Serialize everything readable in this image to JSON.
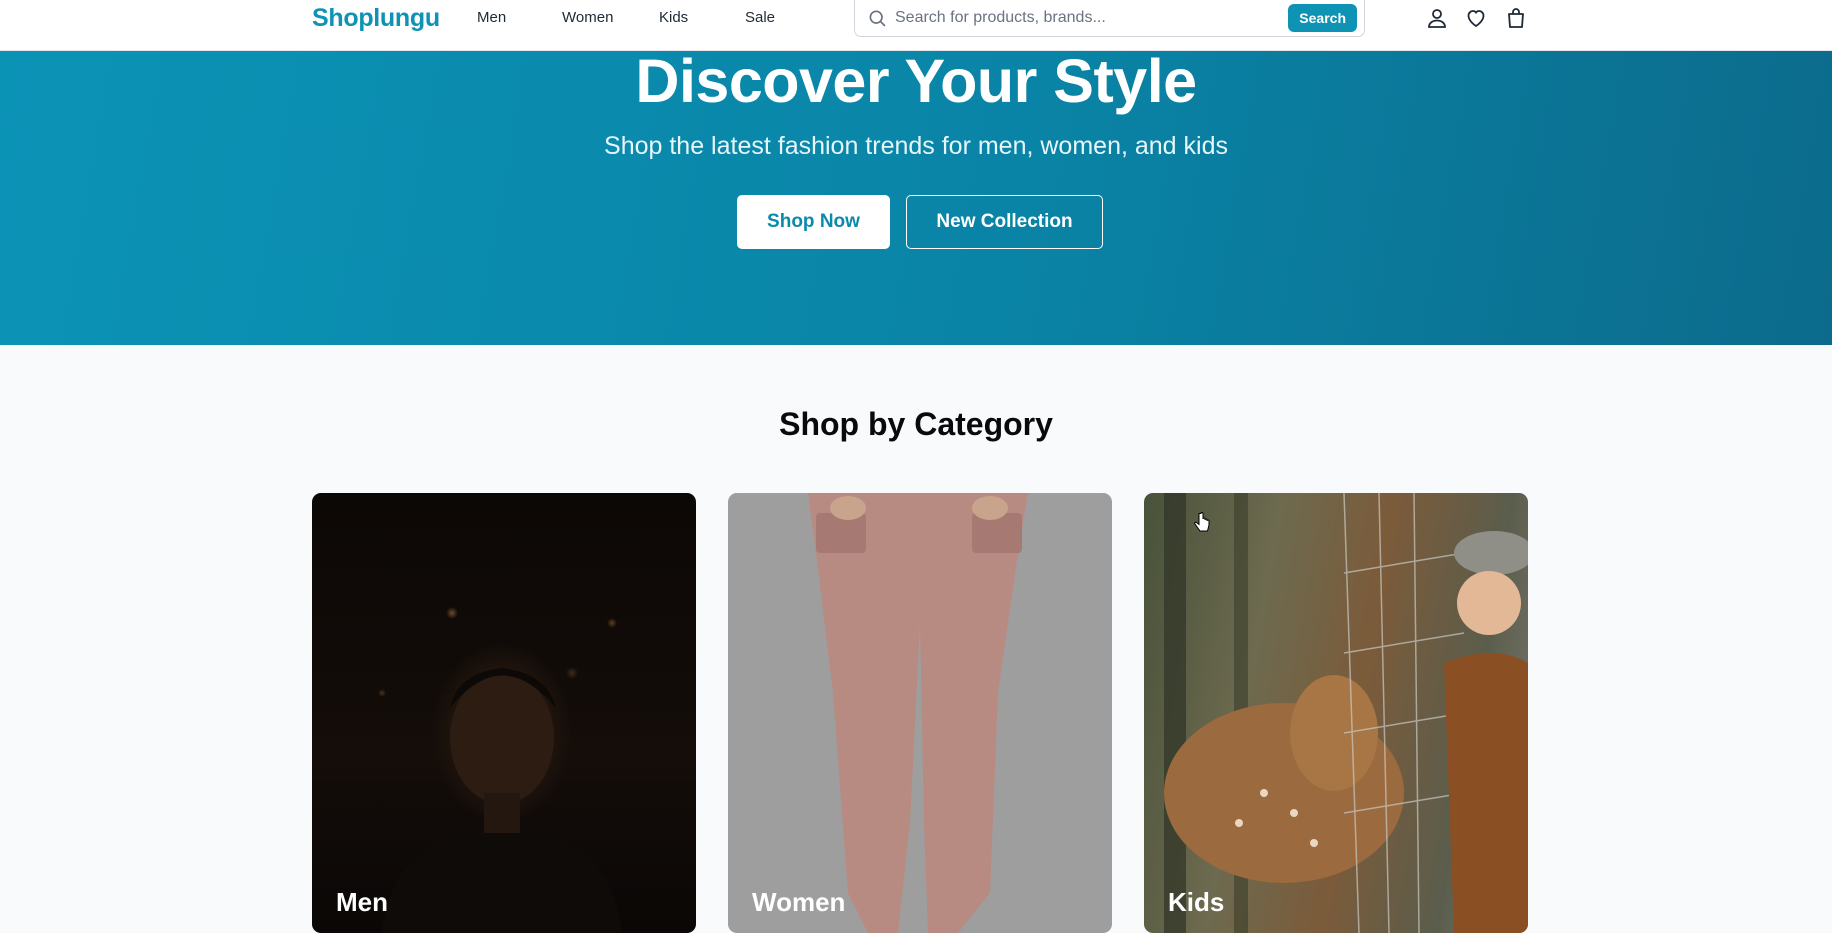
{
  "header": {
    "logo": "Shoplungu",
    "nav": [
      {
        "label": "Men"
      },
      {
        "label": "Women"
      },
      {
        "label": "Kids"
      },
      {
        "label": "Sale"
      }
    ],
    "search": {
      "placeholder": "Search for products, brands...",
      "value": "",
      "button_label": "Search"
    },
    "icons": [
      "user-icon",
      "heart-icon",
      "shopping-bag-icon"
    ]
  },
  "hero": {
    "title": "Discover Your Style",
    "subtitle": "Shop the latest fashion trends for men, women, and kids",
    "primary_button": "Shop Now",
    "secondary_button": "New Collection"
  },
  "categories": {
    "title": "Shop by Category",
    "cards": [
      {
        "label": "Men"
      },
      {
        "label": "Women"
      },
      {
        "label": "Kids"
      }
    ]
  },
  "colors": {
    "brand": "#0e93b5",
    "hero_start": "#0b93b6",
    "hero_end": "#0c6b8c"
  }
}
